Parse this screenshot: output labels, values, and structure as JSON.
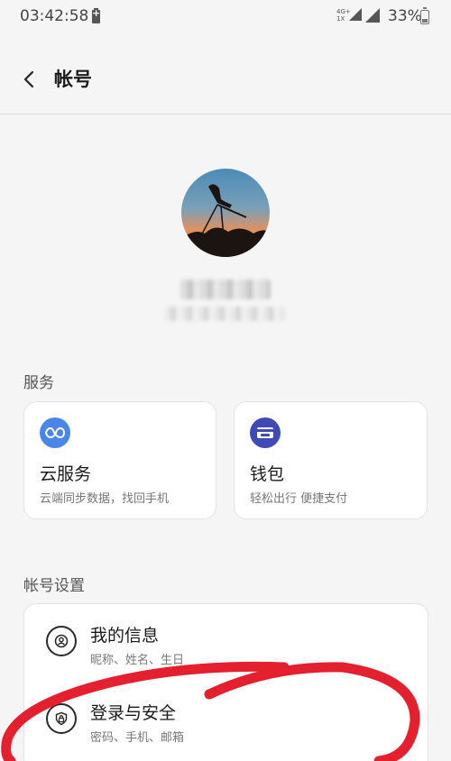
{
  "status_bar": {
    "time": "03:42:58",
    "network_top": "4G+",
    "network_bottom": "1X",
    "battery_percent": "33%",
    "battery_level": 0.33
  },
  "header": {
    "title": "帐号"
  },
  "services": {
    "section_title": "服务",
    "cards": [
      {
        "title": "云服务",
        "desc": "云端同步数据，找回手机",
        "icon": "cloud-infinity-icon",
        "icon_color": "#4a86e8"
      },
      {
        "title": "钱包",
        "desc": "轻松出行 便捷支付",
        "icon": "wallet-icon",
        "icon_color": "#3f4bb5"
      }
    ]
  },
  "account_settings": {
    "section_title": "帐号设置",
    "items": [
      {
        "label": "我的信息",
        "sub": "昵称、姓名、生日",
        "icon": "person-icon"
      },
      {
        "label": "登录与安全",
        "sub": "密码、手机、邮箱",
        "icon": "shield-lock-icon"
      }
    ]
  },
  "colors": {
    "background": "#f5f5f5",
    "card": "#ffffff",
    "annotation": "#e5202e"
  }
}
